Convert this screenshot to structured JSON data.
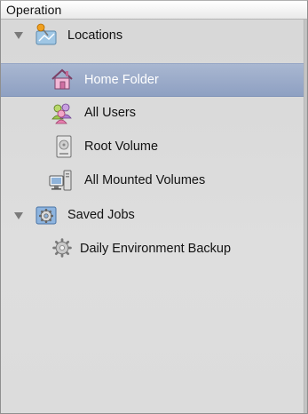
{
  "header": {
    "title": "Operation"
  },
  "tree": {
    "locations": {
      "label": "Locations",
      "icon": "locations-pin-map-icon",
      "items": [
        {
          "label": "Home Folder",
          "icon": "home-folder-icon",
          "selected": true
        },
        {
          "label": "All Users",
          "icon": "all-users-icon",
          "selected": false
        },
        {
          "label": "Root Volume",
          "icon": "root-volume-icon",
          "selected": false
        },
        {
          "label": "All Mounted Volumes",
          "icon": "mounted-volumes-icon",
          "selected": false
        }
      ]
    },
    "saved_jobs": {
      "label": "Saved Jobs",
      "icon": "saved-jobs-gear-icon",
      "items": [
        {
          "label": "Daily Environment Backup",
          "icon": "job-gear-icon",
          "selected": false
        }
      ]
    }
  },
  "colors": {
    "selection": "#9aabc9",
    "panel_bg": "#dadada",
    "header_bg": "#f4f4f4"
  }
}
